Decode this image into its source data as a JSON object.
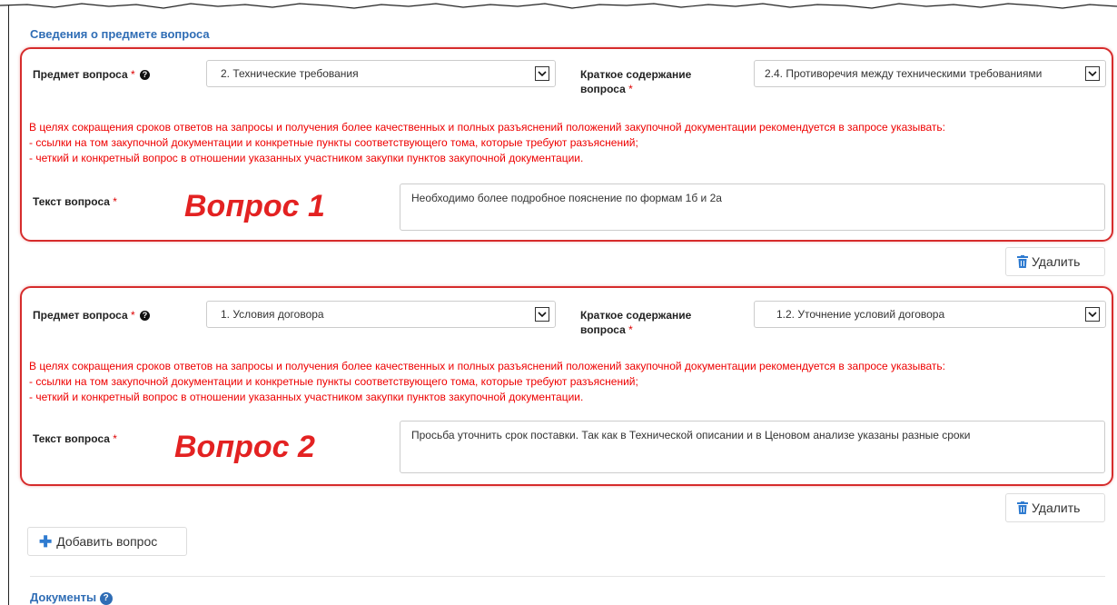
{
  "section_title": "Сведения о предмете вопроса",
  "questions": [
    {
      "subject_label": "Предмет вопроса",
      "subject_value": "2. Технические требования",
      "summary_label_line1": "Краткое содержание",
      "summary_label_line2": "вопроса",
      "summary_value": "2.4. Противоречия между техническими требованиями",
      "warning": [
        "В целях сокращения сроков ответов на запросы и получения более качественных и полных разъяснений положений закупочной документации рекомендуется в запросе указывать:",
        "- ссылки на том закупочной документации и конкретные пункты соответствующего тома, которые требуют разъяснений;",
        "- четкий и конкретный вопрос в отношении указанных участником закупки пунктов закупочной документации."
      ],
      "text_label": "Текст вопроса",
      "text_value": "Необходимо более подробное пояснение по формам 1б и 2а",
      "annotation": "Вопрос 1",
      "delete_label": "Удалить"
    },
    {
      "subject_label": "Предмет вопроса",
      "subject_value": "1. Условия договора",
      "summary_label_line1": "Краткое содержание",
      "summary_label_line2": "вопроса",
      "summary_value": "1.2. Уточнение условий договора",
      "warning": [
        "В целях сокращения сроков ответов на запросы и получения более качественных и полных разъяснений положений закупочной документации рекомендуется в запросе указывать:",
        "- ссылки на том закупочной документации и конкретные пункты соответствующего тома, которые требуют разъяснений;",
        "- четкий и конкретный вопрос в отношении указанных участником закупки пунктов закупочной документации."
      ],
      "text_label": "Текст вопроса",
      "text_value": "Просьба уточнить срок поставки. Так как в Технической описании и в Ценовом анализе указаны разные сроки",
      "annotation": "Вопрос 2",
      "delete_label": "Удалить"
    }
  ],
  "required_mark": "*",
  "help_glyph": "?",
  "add_question_label": "Добавить вопрос",
  "documents_title": "Документы",
  "colors": {
    "accent": "#2f6db5",
    "warning": "#e00000",
    "annotation": "#e32222"
  }
}
